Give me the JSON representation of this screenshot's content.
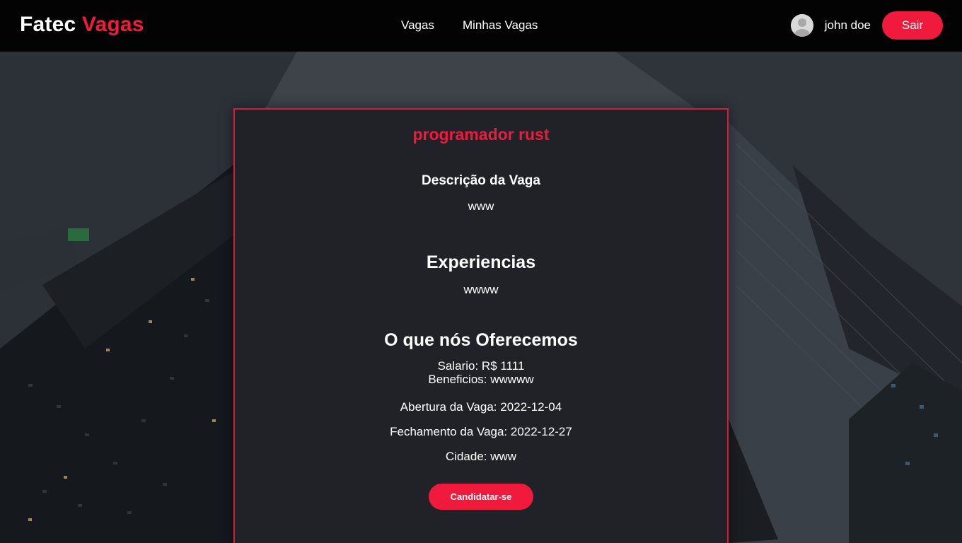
{
  "navbar": {
    "brand_main": "Fatec",
    "brand_accent": "Vagas",
    "links": [
      {
        "label": "Vagas"
      },
      {
        "label": "Minhas Vagas"
      }
    ],
    "user_name": "john doe",
    "logout_label": "Sair"
  },
  "job": {
    "title": "programador rust",
    "description_heading": "Descrição da Vaga",
    "description_text": "www",
    "experience_heading": "Experiencias",
    "experience_text": "wwww",
    "offer_heading": "O que nós Oferecemos",
    "salary": "Salario: R$ 1111",
    "benefits": "Beneficios: wwwww",
    "opening": "Abertura da Vaga: 2022-12-04",
    "closing": "Fechamento da Vaga: 2022-12-27",
    "city": "Cidade: www",
    "apply_label": "Candidatar-se"
  },
  "colors": {
    "accent": "#ef1a3c",
    "navbar_bg": "#030303",
    "card_bg": "#212227",
    "card_border": "#d81a3c"
  },
  "icons": {
    "avatar": "user-avatar-icon"
  }
}
